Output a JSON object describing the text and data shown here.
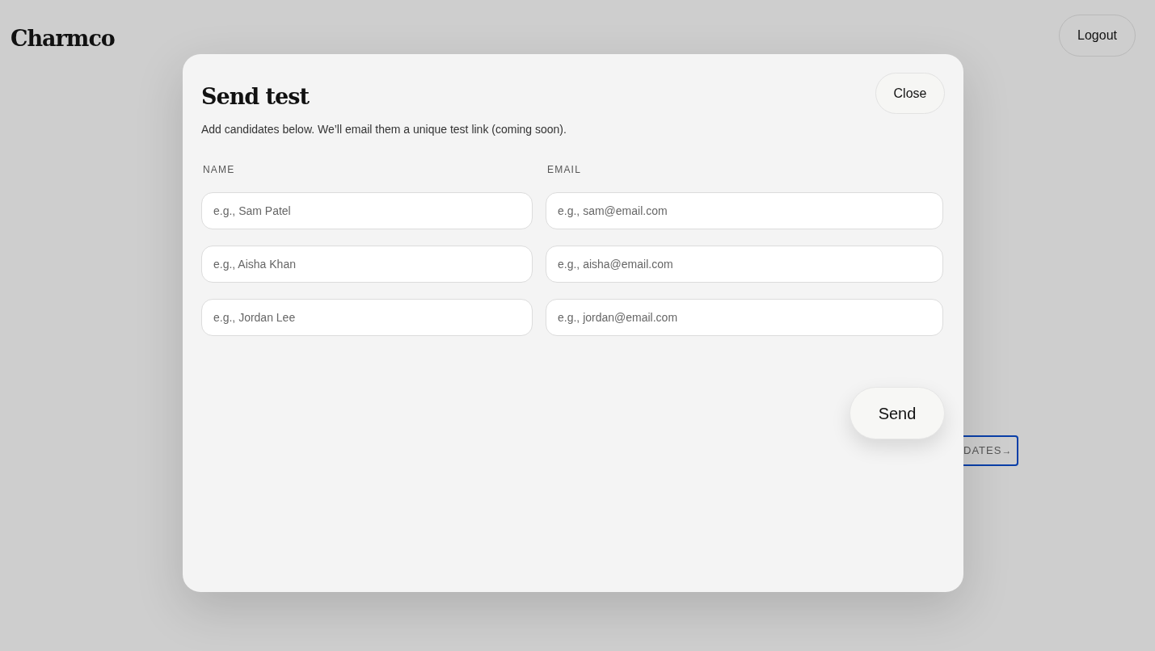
{
  "header": {
    "logo": "Charmco",
    "logout": "Logout"
  },
  "background_button": {
    "label": "DATES",
    "arrow": "→"
  },
  "modal": {
    "title": "Send test",
    "close": "Close",
    "description": "Add candidates below. We’ll email them a unique test link (coming soon).",
    "columns": [
      "NAME",
      "EMAIL"
    ],
    "rows": [
      {
        "name_placeholder": "e.g., Sam Patel",
        "email_placeholder": "e.g., sam@email.com"
      },
      {
        "name_placeholder": "e.g., Aisha Khan",
        "email_placeholder": "e.g., aisha@email.com"
      },
      {
        "name_placeholder": "e.g., Jordan Lee",
        "email_placeholder": "e.g., jordan@email.com"
      }
    ],
    "send": "Send"
  }
}
